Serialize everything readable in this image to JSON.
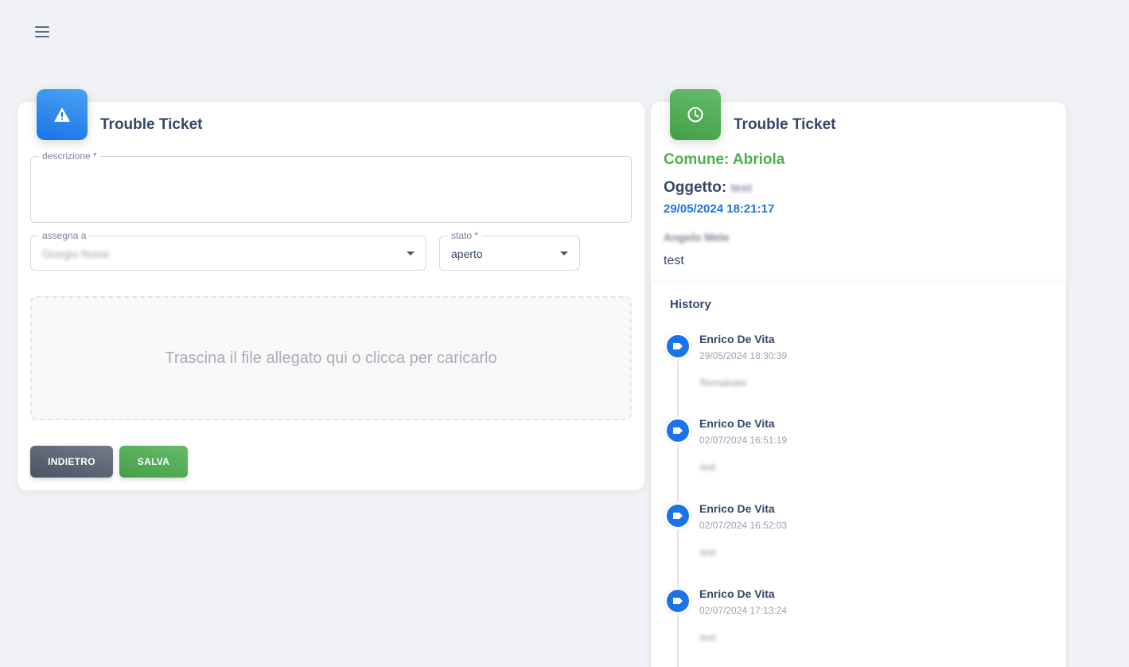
{
  "left_card": {
    "title": "Trouble Ticket",
    "fields": {
      "descrizione_label": "descrizione *",
      "descrizione_value": "",
      "assegna_label": "assegna a",
      "assegna_value": "Giorgio Rossi",
      "stato_label": "stato *",
      "stato_value": "aperto"
    },
    "dropzone_text": "Trascina il file allegato qui o clicca per caricarlo",
    "buttons": {
      "back": "INDIETRO",
      "save": "SALVA"
    }
  },
  "right_card": {
    "title": "Trouble Ticket",
    "comune": "Comune: Abriola",
    "oggetto_label": "Oggetto:",
    "oggetto_value": "test",
    "date": "29/05/2024 18:21:17",
    "assegnato": "Angelo Mele",
    "description": "test",
    "history": {
      "title": "History",
      "items": [
        {
          "name": "Enrico De Vita",
          "date": "29/05/2024 18:30:39",
          "note": "Remainder"
        },
        {
          "name": "Enrico De Vita",
          "date": "02/07/2024 16:51:19",
          "note": "test"
        },
        {
          "name": "Enrico De Vita",
          "date": "02/07/2024 16:52:03",
          "note": "test"
        },
        {
          "name": "Enrico De Vita",
          "date": "02/07/2024 17:13:24",
          "note": "test"
        }
      ]
    }
  },
  "colors": {
    "background": "#f0f2f5",
    "primary_blue": "#1A73E8",
    "success_green": "#4CAF50",
    "dark_button": "#495361"
  },
  "icons": {
    "menu": "hamburger-menu-icon",
    "left_header": "warning-icon",
    "right_header": "clock-icon",
    "timeline": "label-tag-icon"
  }
}
